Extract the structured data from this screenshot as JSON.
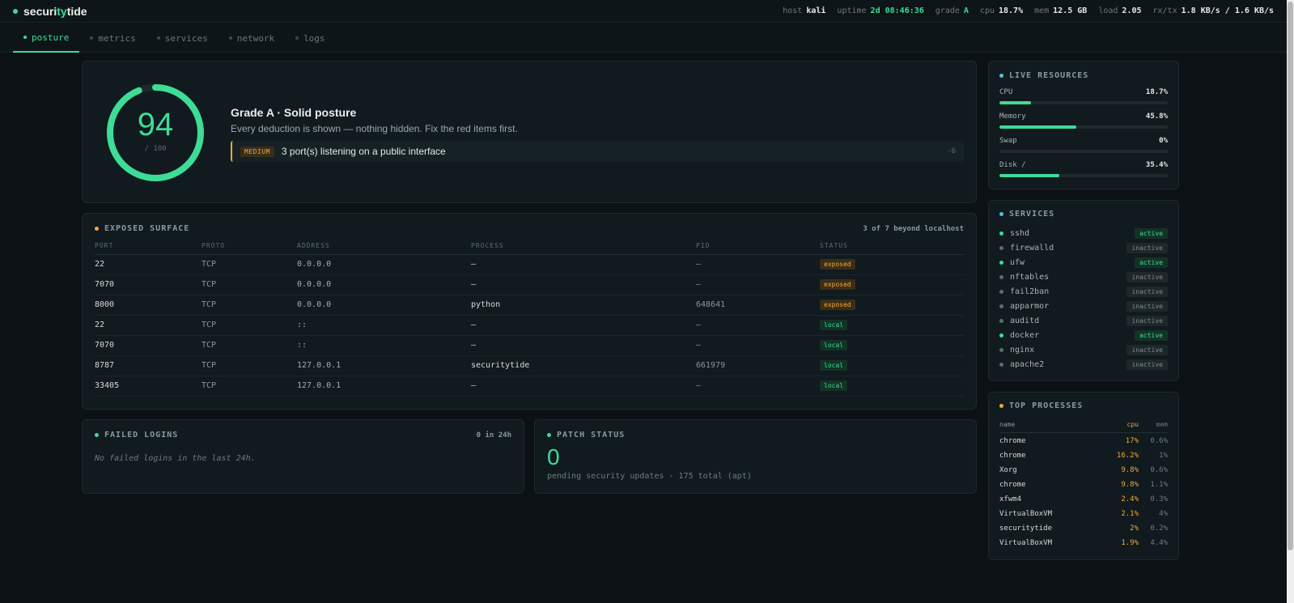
{
  "brand": {
    "prefix": "securi",
    "accent": "ty",
    "suffix": "tide"
  },
  "stats": [
    {
      "label": "host",
      "value": "kali",
      "green": false
    },
    {
      "label": "uptime",
      "value": "2d 08:46:36",
      "green": true
    },
    {
      "label": "grade",
      "value": "A",
      "green": true
    },
    {
      "label": "cpu",
      "value": "18.7%",
      "green": false
    },
    {
      "label": "mem",
      "value": "12.5 GB",
      "green": false
    },
    {
      "label": "load",
      "value": "2.05",
      "green": false
    },
    {
      "label": "rx/tx",
      "value": "1.8 KB/s / 1.6 KB/s",
      "green": false
    }
  ],
  "tabs": [
    {
      "label": "posture",
      "active": true
    },
    {
      "label": "metrics",
      "active": false
    },
    {
      "label": "services",
      "active": false
    },
    {
      "label": "network",
      "active": false
    },
    {
      "label": "logs",
      "active": false
    }
  ],
  "posture": {
    "score": "94",
    "score_value": 94,
    "score_max": "/ 100",
    "grade_line": "Grade A · Solid posture",
    "subtitle": "Every deduction is shown — nothing hidden. Fix the red items first.",
    "finding": {
      "severity": "MEDIUM",
      "text": "3 port(s) listening on a public interface",
      "points": "-6"
    }
  },
  "exposed": {
    "title": "EXPOSED SURFACE",
    "summary": "3 of 7 beyond localhost",
    "columns": [
      "PORT",
      "PROTO",
      "ADDRESS",
      "PROCESS",
      "PID",
      "STATUS"
    ],
    "rows": [
      {
        "port": "22",
        "proto": "TCP",
        "address": "0.0.0.0",
        "process": "—",
        "pid": "—",
        "status": "exposed"
      },
      {
        "port": "7070",
        "proto": "TCP",
        "address": "0.0.0.0",
        "process": "—",
        "pid": "—",
        "status": "exposed"
      },
      {
        "port": "8000",
        "proto": "TCP",
        "address": "0.0.0.0",
        "process": "python",
        "pid": "648641",
        "status": "exposed"
      },
      {
        "port": "22",
        "proto": "TCP",
        "address": "::",
        "process": "—",
        "pid": "—",
        "status": "local"
      },
      {
        "port": "7070",
        "proto": "TCP",
        "address": "::",
        "process": "—",
        "pid": "—",
        "status": "local"
      },
      {
        "port": "8787",
        "proto": "TCP",
        "address": "127.0.0.1",
        "process": "securitytide",
        "pid": "661979",
        "status": "local"
      },
      {
        "port": "33405",
        "proto": "TCP",
        "address": "127.0.0.1",
        "process": "—",
        "pid": "—",
        "status": "local"
      }
    ]
  },
  "failed_logins": {
    "title": "FAILED LOGINS",
    "summary": "0 in 24h",
    "message": "No failed logins in the last 24h."
  },
  "patch_status": {
    "title": "PATCH STATUS",
    "count": "0",
    "detail": "pending security updates · 175 total (apt)"
  },
  "live_resources": {
    "title": "LIVE RESOURCES",
    "items": [
      {
        "label": "CPU",
        "value": "18.7%",
        "level": 18.7
      },
      {
        "label": "Memory",
        "value": "45.8%",
        "level": 45.8
      },
      {
        "label": "Swap",
        "value": "0%",
        "level": 0
      },
      {
        "label": "Disk /",
        "value": "35.4%",
        "level": 35.4
      }
    ]
  },
  "services": {
    "title": "SERVICES",
    "items": [
      {
        "name": "sshd",
        "state": "active"
      },
      {
        "name": "firewalld",
        "state": "inactive"
      },
      {
        "name": "ufw",
        "state": "active"
      },
      {
        "name": "nftables",
        "state": "inactive"
      },
      {
        "name": "fail2ban",
        "state": "inactive"
      },
      {
        "name": "apparmor",
        "state": "inactive"
      },
      {
        "name": "auditd",
        "state": "inactive"
      },
      {
        "name": "docker",
        "state": "active"
      },
      {
        "name": "nginx",
        "state": "inactive"
      },
      {
        "name": "apache2",
        "state": "inactive"
      }
    ]
  },
  "top_processes": {
    "title": "TOP PROCESSES",
    "columns": {
      "name": "name",
      "cpu": "cpu",
      "mem": "mem"
    },
    "items": [
      {
        "name": "chrome",
        "cpu": "17%",
        "mem": "0.6%"
      },
      {
        "name": "chrome",
        "cpu": "16.2%",
        "mem": "1%"
      },
      {
        "name": "Xorg",
        "cpu": "9.8%",
        "mem": "0.6%"
      },
      {
        "name": "chrome",
        "cpu": "9.8%",
        "mem": "1.1%"
      },
      {
        "name": "xfwm4",
        "cpu": "2.4%",
        "mem": "0.3%"
      },
      {
        "name": "VirtualBoxVM",
        "cpu": "2.1%",
        "mem": "4%"
      },
      {
        "name": "securitytide",
        "cpu": "2%",
        "mem": "0.2%"
      },
      {
        "name": "VirtualBoxVM",
        "cpu": "1.9%",
        "mem": "4.4%"
      }
    ]
  }
}
